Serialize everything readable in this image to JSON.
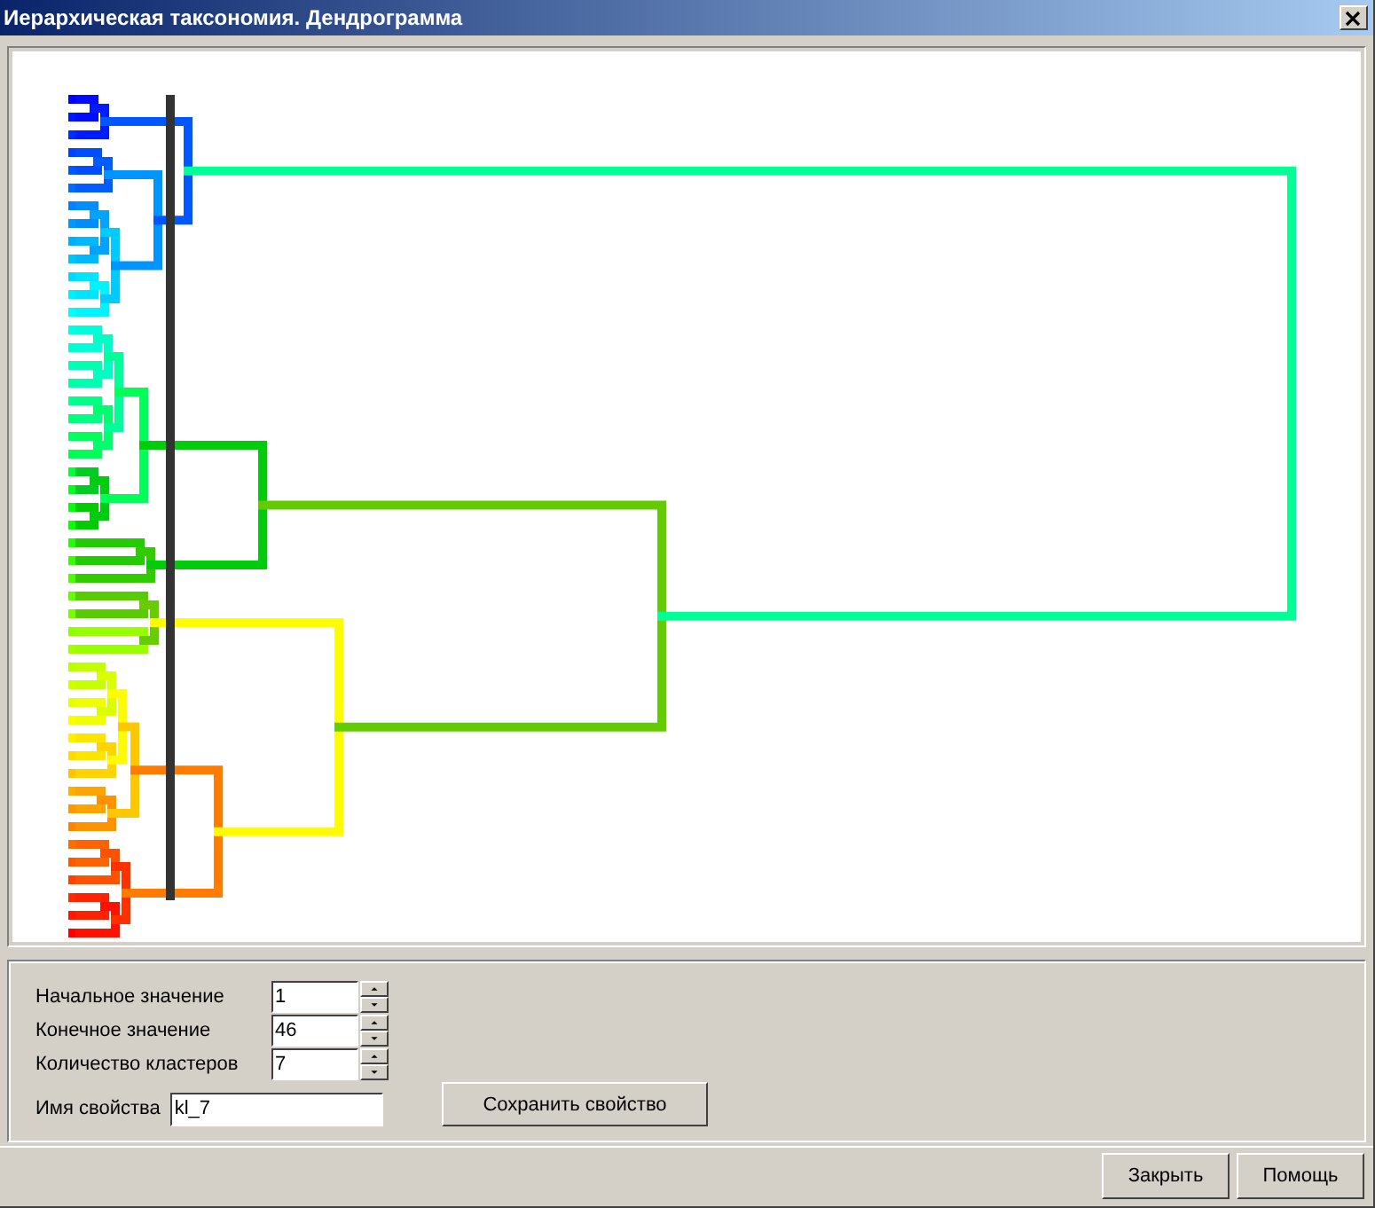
{
  "window": {
    "title": "Иерархическая таксономия. Дендрограмма"
  },
  "spinners": [
    {
      "label": "Начальное значение",
      "value": "1"
    },
    {
      "label": "Конечное значение",
      "value": "46"
    },
    {
      "label": "Количество кластеров",
      "value": "7"
    }
  ],
  "property_name": {
    "label": "Имя свойства",
    "value": "kl_7"
  },
  "save_button": "Сохранить свойство",
  "buttons": [
    "Закрыть",
    "Помощь"
  ]
}
